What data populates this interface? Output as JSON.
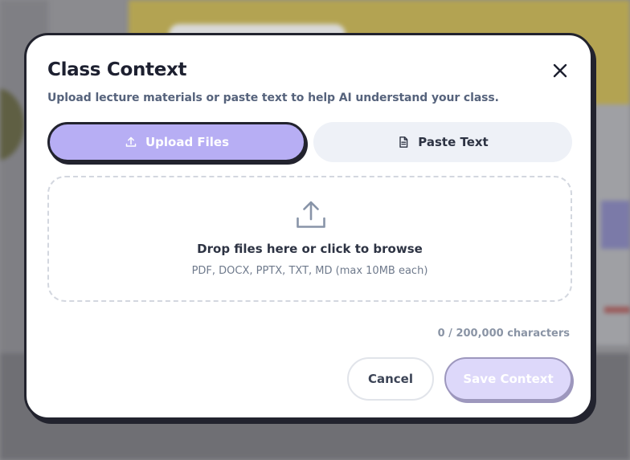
{
  "modal": {
    "title": "Class Context",
    "subtitle": "Upload lecture materials or paste text to help AI understand your class.",
    "close_icon": "close-icon"
  },
  "tabs": [
    {
      "label": "Upload Files",
      "icon": "upload-icon",
      "active": true
    },
    {
      "label": "Paste Text",
      "icon": "document-icon",
      "active": false
    }
  ],
  "dropzone": {
    "icon": "upload-icon",
    "title": "Drop files here or click to browse",
    "subtitle": "PDF, DOCX, PPTX, TXT, MD (max 10MB each)"
  },
  "char_count": "0 / 200,000 characters",
  "buttons": {
    "cancel_label": "Cancel",
    "save_label": "Save Context"
  },
  "colors": {
    "accent": "#b7aef4",
    "accent_disabled": "#ddd8fa",
    "border_dark": "#22232e",
    "text_dark": "#1d2030",
    "text_muted": "#56637c"
  }
}
